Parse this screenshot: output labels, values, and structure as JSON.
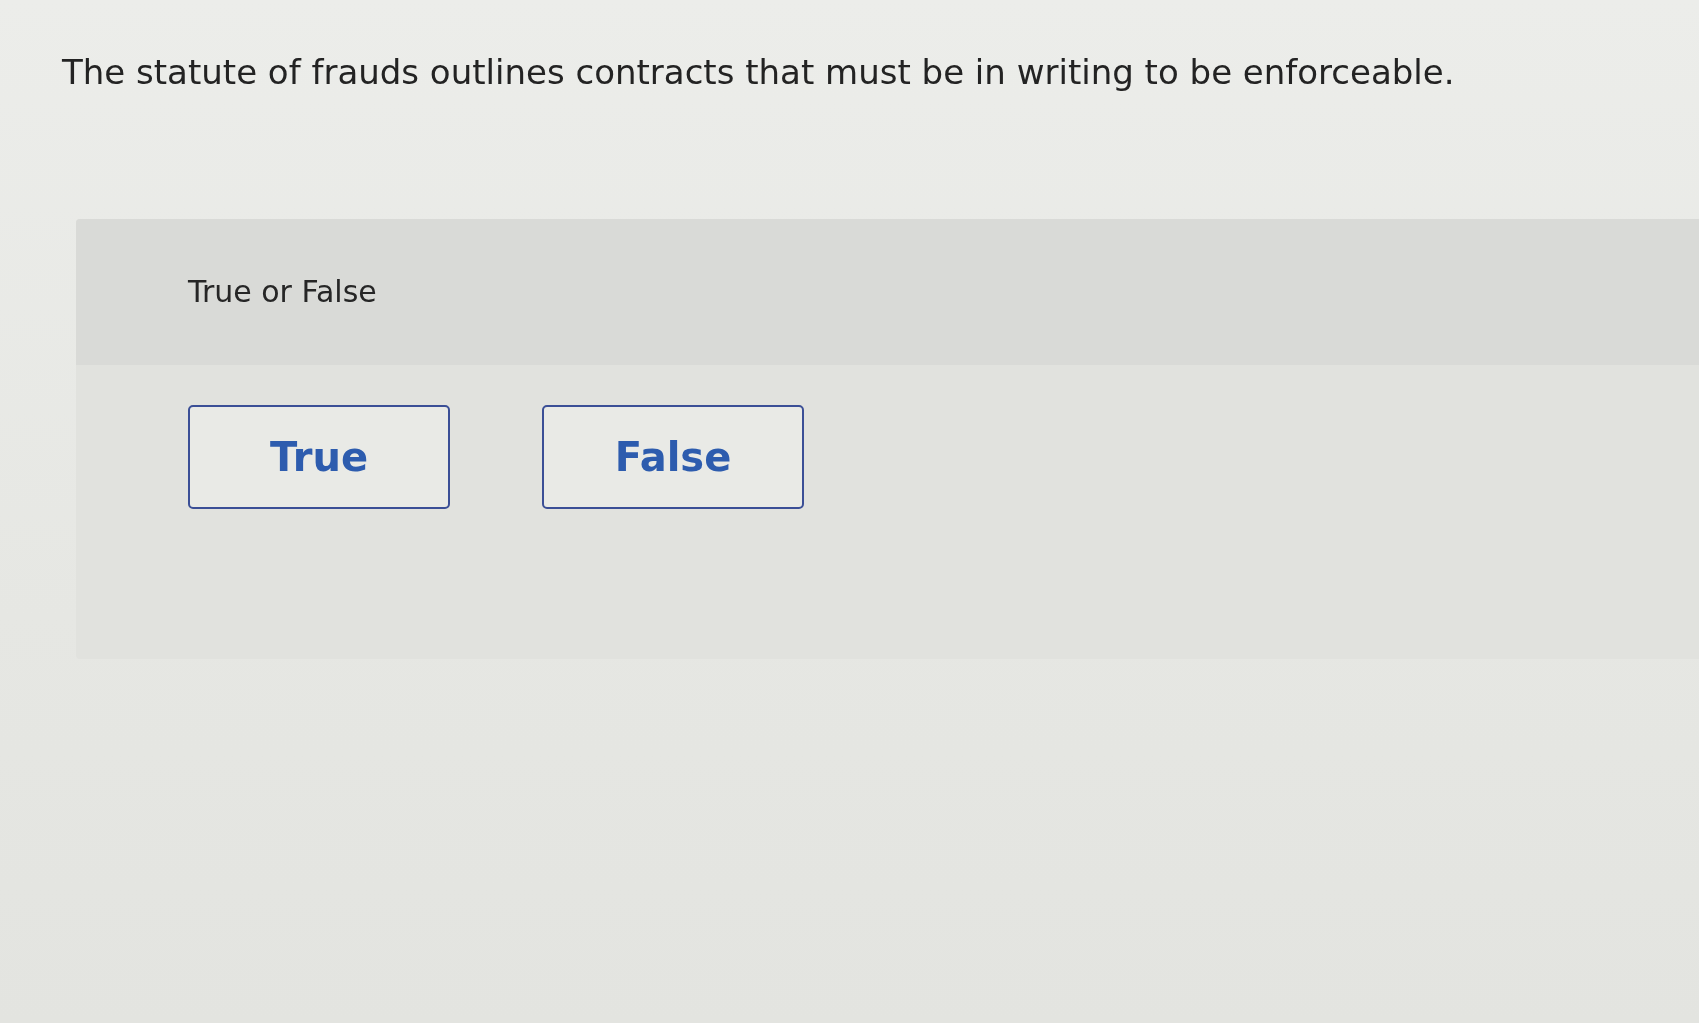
{
  "question": {
    "text": "The statute of frauds outlines contracts that must be in writing to be enforceable."
  },
  "answer_panel": {
    "prompt": "True or False",
    "options": [
      {
        "label": "True",
        "selected": false
      },
      {
        "label": "False",
        "selected": false
      }
    ]
  }
}
